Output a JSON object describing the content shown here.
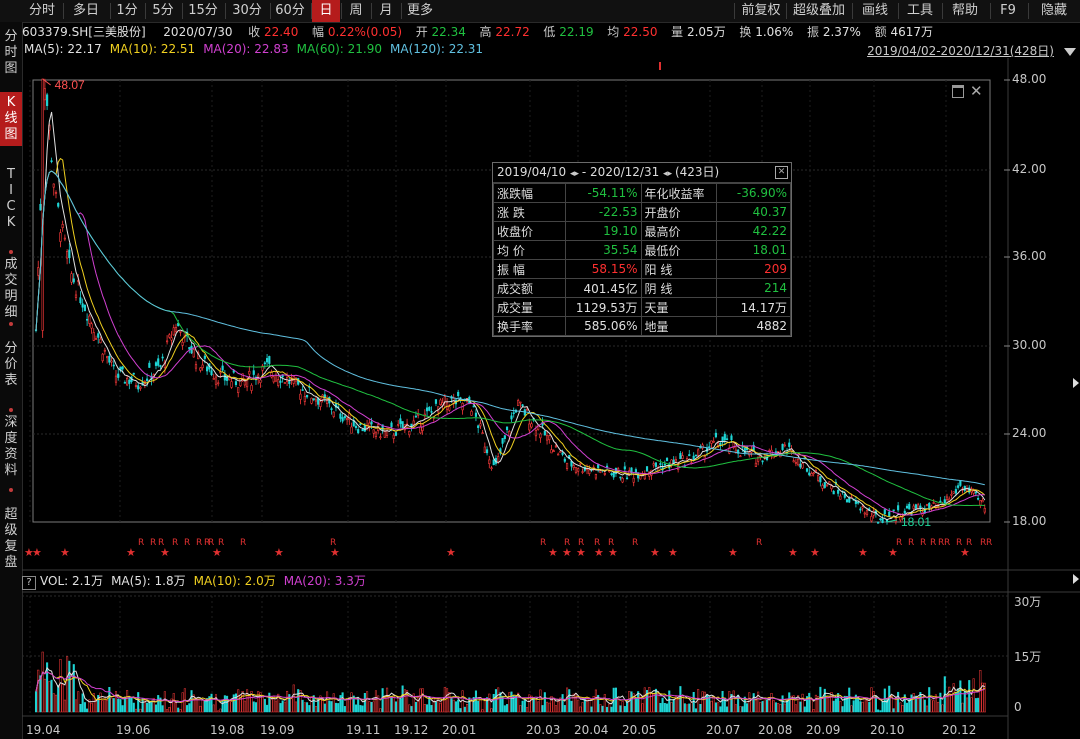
{
  "period_tabs": [
    {
      "label": "分时",
      "active": false
    },
    {
      "label": "多日",
      "active": false
    },
    {
      "label": "1分",
      "active": false
    },
    {
      "label": "5分",
      "active": false
    },
    {
      "label": "15分",
      "active": false
    },
    {
      "label": "30分",
      "active": false
    },
    {
      "label": "60分",
      "active": false
    },
    {
      "label": "日",
      "active": true
    },
    {
      "label": "周",
      "active": false
    },
    {
      "label": "月",
      "active": false
    },
    {
      "label": "更多",
      "active": false
    }
  ],
  "toolbar_right": [
    "前复权",
    "超级叠加",
    "画线",
    "工具",
    "帮助",
    "F9",
    "隐藏"
  ],
  "sidebar": [
    {
      "label": "分时图",
      "active": false
    },
    {
      "label": "K线图",
      "active": true
    },
    {
      "label": "TICK",
      "active": false
    },
    {
      "label": "成交明细",
      "active": false
    },
    {
      "label": "分价表",
      "active": false
    },
    {
      "label": "深度资料",
      "active": false
    },
    {
      "label": "超级复盘",
      "active": false
    }
  ],
  "quote": {
    "code": "603379.SH[三美股份]",
    "date": "2020/07/30",
    "close_label": "收",
    "close": "22.40",
    "change_label": "幅",
    "change": "0.22%(0.05)",
    "open_label": "开",
    "open": "22.34",
    "high_label": "高",
    "high": "22.72",
    "low_label": "低",
    "low": "22.19",
    "avg_label": "均",
    "avg": "22.50",
    "volume_label": "量",
    "volume": "2.05万",
    "turnover_label": "换",
    "turnover": "1.06%",
    "amplitude_label": "振",
    "amplitude": "2.37%",
    "amount_label": "额",
    "amount": "4617万"
  },
  "ma_line": [
    {
      "label": "MA(5): 22.17",
      "color": "#e0e0e0"
    },
    {
      "label": "MA(10): 22.51",
      "color": "#f0d020"
    },
    {
      "label": "MA(20): 22.83",
      "color": "#d040d0"
    },
    {
      "label": "MA(60): 21.90",
      "color": "#20c040"
    },
    {
      "label": "MA(120): 22.31",
      "color": "#60c0e0"
    }
  ],
  "range_label": "2019/04/02-2020/12/31(428日)",
  "price_axis": [
    "48.00",
    "42.00",
    "36.00",
    "30.00",
    "24.00",
    "18.00"
  ],
  "vol_axis": [
    "30万",
    "15万",
    "0"
  ],
  "x_axis": [
    "19.04",
    "19.06",
    "19.08",
    "19.09",
    "19.11",
    "19.12",
    "20.01",
    "20.03",
    "20.04",
    "20.05",
    "20.07",
    "20.08",
    "20.09",
    "20.10",
    "20.12"
  ],
  "max_label": "48.07",
  "min_label": "18.01",
  "popup": {
    "start": "2019/04/10",
    "end": "- 2020/12/31",
    "days": "(423日)",
    "rows": [
      {
        "k1": "涨跌幅",
        "v1": "-54.11%",
        "c1": "#20c040",
        "k2": "年化收益率",
        "v2": "-36.90%",
        "c2": "#20c040"
      },
      {
        "k1": "涨  跌",
        "v1": "-22.53",
        "c1": "#20c040",
        "k2": "开盘价",
        "v2": "40.37",
        "c2": "#20c040"
      },
      {
        "k1": "收盘价",
        "v1": "19.10",
        "c1": "#20c040",
        "k2": "最高价",
        "v2": "42.22",
        "c2": "#20c040"
      },
      {
        "k1": "均  价",
        "v1": "35.54",
        "c1": "#20c040",
        "k2": "最低价",
        "v2": "18.01",
        "c2": "#20c040"
      },
      {
        "k1": "振  幅",
        "v1": "58.15%",
        "c1": "#ff3030",
        "k2": "阳  线",
        "v2": "209",
        "c2": "#ff3030"
      },
      {
        "k1": "成交额",
        "v1": "401.45亿",
        "c1": "#e0e0e0",
        "k2": "阴  线",
        "v2": "214",
        "c2": "#20c040"
      },
      {
        "k1": "成交量",
        "v1": "1129.53万",
        "c1": "#e0e0e0",
        "k2": "天量",
        "v2": "14.17万",
        "c2": "#e0e0e0"
      },
      {
        "k1": "换手率",
        "v1": "585.06%",
        "c1": "#e0e0e0",
        "k2": "地量",
        "v2": "4882",
        "c2": "#e0e0e0"
      }
    ]
  },
  "vol_header": {
    "q": "?",
    "items": [
      {
        "label": "VOL: 2.1万",
        "color": "#e0e0e0"
      },
      {
        "label": "MA(5): 1.8万",
        "color": "#e0e0e0"
      },
      {
        "label": "MA(10): 2.0万",
        "color": "#f0d020"
      },
      {
        "label": "MA(20): 3.3万",
        "color": "#d040d0"
      }
    ]
  },
  "chart_data": {
    "type": "candlestick",
    "price_range": [
      18.0,
      48.0
    ],
    "close_trend": [
      [
        "2019/04/02",
        31.0
      ],
      [
        "2019/04/08",
        48.07
      ],
      [
        "2019/04/15",
        40.0
      ],
      [
        "2019/04/25",
        35.0
      ],
      [
        "2019/05/10",
        31.5
      ],
      [
        "2019/05/25",
        28.0
      ],
      [
        "2019/06/10",
        27.5
      ],
      [
        "2019/06/25",
        28.5
      ],
      [
        "2019/07/05",
        31.5
      ],
      [
        "2019/07/20",
        29.0
      ],
      [
        "2019/08/05",
        27.8
      ],
      [
        "2019/08/20",
        27.5
      ],
      [
        "2019/09/05",
        28.5
      ],
      [
        "2019/09/25",
        27.2
      ],
      [
        "2019/10/15",
        26.0
      ],
      [
        "2019/11/05",
        24.5
      ],
      [
        "2019/11/25",
        24.0
      ],
      [
        "2019/12/15",
        24.8
      ],
      [
        "2020/01/05",
        26.2
      ],
      [
        "2020/01/20",
        26.0
      ],
      [
        "2020/02/05",
        21.5
      ],
      [
        "2020/02/20",
        26.0
      ],
      [
        "2020/03/05",
        24.5
      ],
      [
        "2020/03/25",
        22.0
      ],
      [
        "2020/04/15",
        21.5
      ],
      [
        "2020/05/05",
        21.2
      ],
      [
        "2020/05/25",
        21.8
      ],
      [
        "2020/06/15",
        22.2
      ],
      [
        "2020/07/05",
        23.5
      ],
      [
        "2020/07/30",
        22.4
      ],
      [
        "2020/08/20",
        23.0
      ],
      [
        "2020/09/10",
        21.0
      ],
      [
        "2020/10/01",
        19.5
      ],
      [
        "2020/10/20",
        18.2
      ],
      [
        "2020/11/10",
        18.8
      ],
      [
        "2020/12/01",
        19.0
      ],
      [
        "2020/12/15",
        20.5
      ],
      [
        "2020/12/31",
        19.1
      ]
    ],
    "volume_scale": [
      0,
      300000
    ]
  }
}
